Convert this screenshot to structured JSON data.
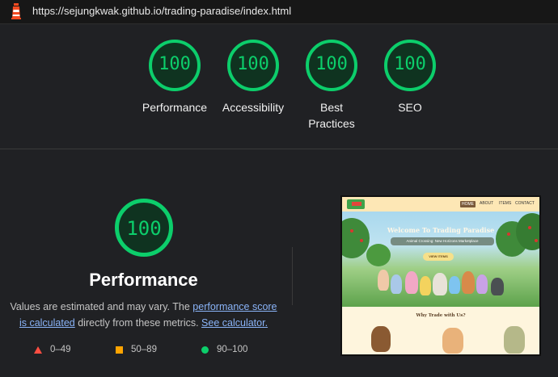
{
  "url_bar": {
    "url": "https://sejungkwak.github.io/trading-paradise/index.html",
    "icon": "lighthouse-icon"
  },
  "summary_gauges": [
    {
      "score": "100",
      "label": "Performance"
    },
    {
      "score": "100",
      "label": "Accessibility"
    },
    {
      "score": "100",
      "label": "Best Practices"
    },
    {
      "score": "100",
      "label": "SEO"
    }
  ],
  "performance": {
    "score": "100",
    "title": "Performance",
    "desc_prefix": "Values are estimated and may vary. The ",
    "link_score": "performance score is calculated",
    "desc_middle": " directly from these metrics. ",
    "link_calc": "See calculator."
  },
  "legend": [
    {
      "icon": "fail-triangle-icon",
      "range": "0–49",
      "color": "#ff4e42"
    },
    {
      "icon": "average-square-icon",
      "range": "50–89",
      "color": "#ffa400"
    },
    {
      "icon": "pass-circle-icon",
      "range": "90–100",
      "color": "#0cce6b"
    }
  ],
  "thumbnail": {
    "nav": [
      "HOME",
      "ABOUT",
      "ITEMS",
      "CONTACT"
    ],
    "hero_title": "Welcome To Trading Paradise",
    "hero_subtitle": "Animal Crossing: New Horizons Marketplace",
    "hero_button": "VIEW ITEMS",
    "section_title": "Why Trade with Us?"
  },
  "colors": {
    "pass": "#0cce6b",
    "background": "#202124",
    "link": "#8ab4f8"
  }
}
